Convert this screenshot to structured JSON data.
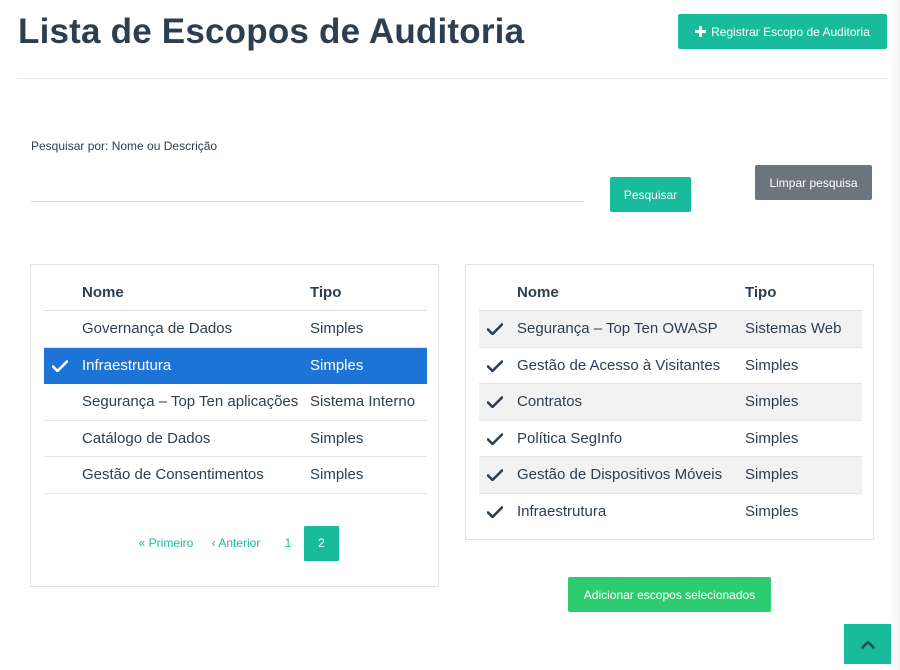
{
  "header": {
    "title": "Lista de Escopos de Auditoria",
    "register_label": "Registrar Escopo de Auditoria"
  },
  "search": {
    "label": "Pesquisar por: Nome ou Descrição",
    "value": "",
    "placeholder": "",
    "search_label": "Pesquisar",
    "clear_label": "Limpar pesquisa"
  },
  "left_table": {
    "col_name": "Nome",
    "col_type": "Tipo",
    "rows": [
      {
        "name": "Governança de Dados",
        "type": "Simples",
        "selected": false
      },
      {
        "name": "Infraestrutura",
        "type": "Simples",
        "selected": true
      },
      {
        "name": "Segurança – Top Ten aplicações",
        "type": "Sistema Interno",
        "selected": false
      },
      {
        "name": "Catálogo de Dados",
        "type": "Simples",
        "selected": false
      },
      {
        "name": "Gestão de Consentimentos",
        "type": "Simples",
        "selected": false
      }
    ],
    "pagination": {
      "first_label": "« Primeiro",
      "prev_label": "‹ Anterior",
      "pages": [
        "1",
        "2"
      ],
      "current_page": "2"
    }
  },
  "right_table": {
    "col_name": "Nome",
    "col_type": "Tipo",
    "rows": [
      {
        "name": "Segurança – Top Ten OWASP",
        "type": "Sistemas Web"
      },
      {
        "name": "Gestão de Acesso à Visitantes",
        "type": "Simples"
      },
      {
        "name": "Contratos",
        "type": "Simples"
      },
      {
        "name": "Política SegInfo",
        "type": "Simples"
      },
      {
        "name": "Gestão de Dispositivos Móveis",
        "type": "Simples"
      },
      {
        "name": "Infraestrutura",
        "type": "Simples"
      }
    ]
  },
  "actions": {
    "add_selected_label": "Adicionar escopos selecionados"
  },
  "icons": {
    "register": "plus-icon",
    "check": "check-icon",
    "back_to_top": "chevron-up-icon"
  },
  "colors": {
    "primary": "#18bc9c",
    "title": "#2c3e50",
    "selected_row": "#1e74d6",
    "clear_button": "#6c757d",
    "add_button": "#2ecc71"
  }
}
